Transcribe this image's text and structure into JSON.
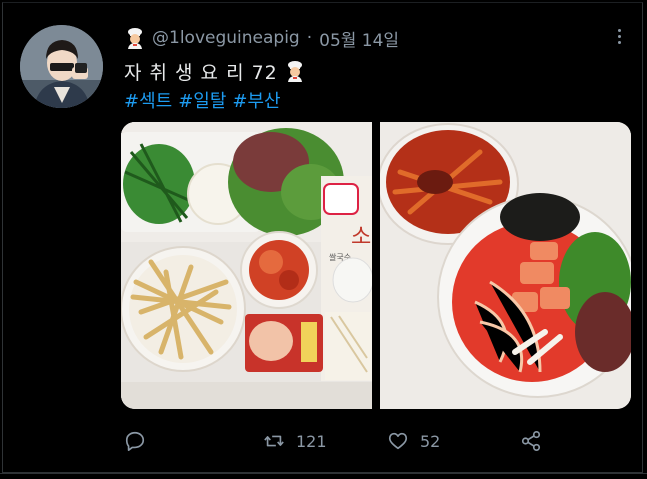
{
  "tweet": {
    "handle": "@1loveguineapig",
    "separator": "·",
    "date": "05월 14일",
    "text": "자 취 생 요 리 72",
    "hashtags": [
      "#섹트",
      "#일탈",
      "#부산"
    ]
  },
  "photos": {
    "left": {
      "content": "food-ingredients-photo",
      "package_label_1": "소",
      "package_label_2": "쌀국수"
    },
    "right": {
      "content": "spicy-noodle-dish-photo"
    }
  },
  "actions": {
    "reply_count": "",
    "retweet_count": "121",
    "like_count": "52"
  },
  "colors": {
    "background": "#000000",
    "text": "#e7e9ea",
    "muted": "#8b98a5",
    "link": "#1d9bf0"
  }
}
